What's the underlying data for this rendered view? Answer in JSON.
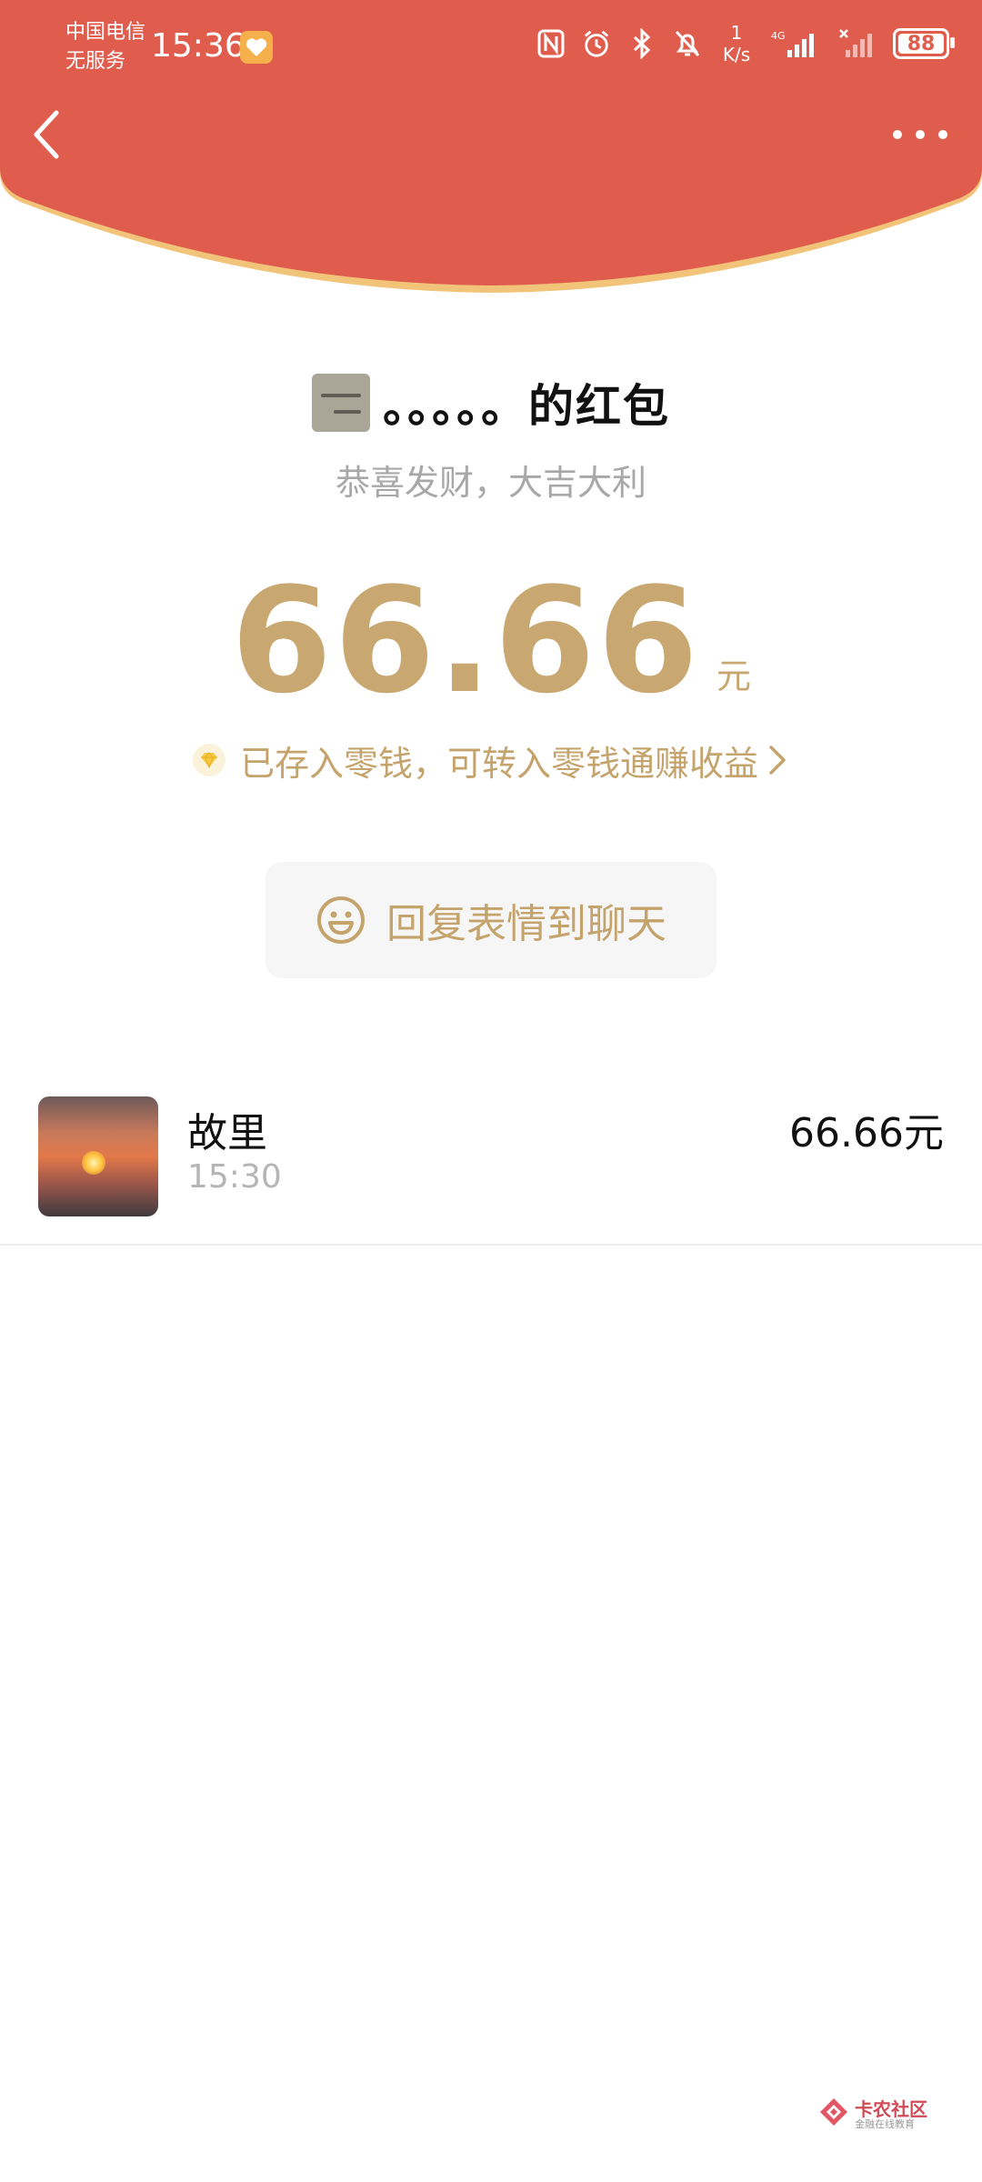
{
  "status_bar": {
    "carrier_line1": "中国电信",
    "carrier_line2": "无服务",
    "time": "15:36",
    "speed_value": "1",
    "speed_unit": "K/s",
    "network_label": "4G",
    "battery": "88",
    "icons": [
      "nfc-icon",
      "alarm-icon",
      "bluetooth-icon",
      "mute-icon",
      "signal-icon",
      "signal-off-icon",
      "battery-icon"
    ]
  },
  "header": {
    "back_icon": "chevron-left-icon",
    "more_icon": "more-icon",
    "color": "#e05d4e",
    "curve_edge_color": "#f2c47a"
  },
  "packet": {
    "sender_name": "。。。。。的红包",
    "blessing": "恭喜发财，大吉大利",
    "amount": "66.66",
    "unit": "元",
    "saved_text": "已存入零钱，可转入零钱通赚收益",
    "reply_label": "回复表情到聊天",
    "accent_color": "#c8a870"
  },
  "receivers": [
    {
      "name": "故里",
      "time": "15:30",
      "amount": "66.66元"
    }
  ],
  "watermark": {
    "title": "卡农社区",
    "subtitle": "金融在线教育"
  }
}
